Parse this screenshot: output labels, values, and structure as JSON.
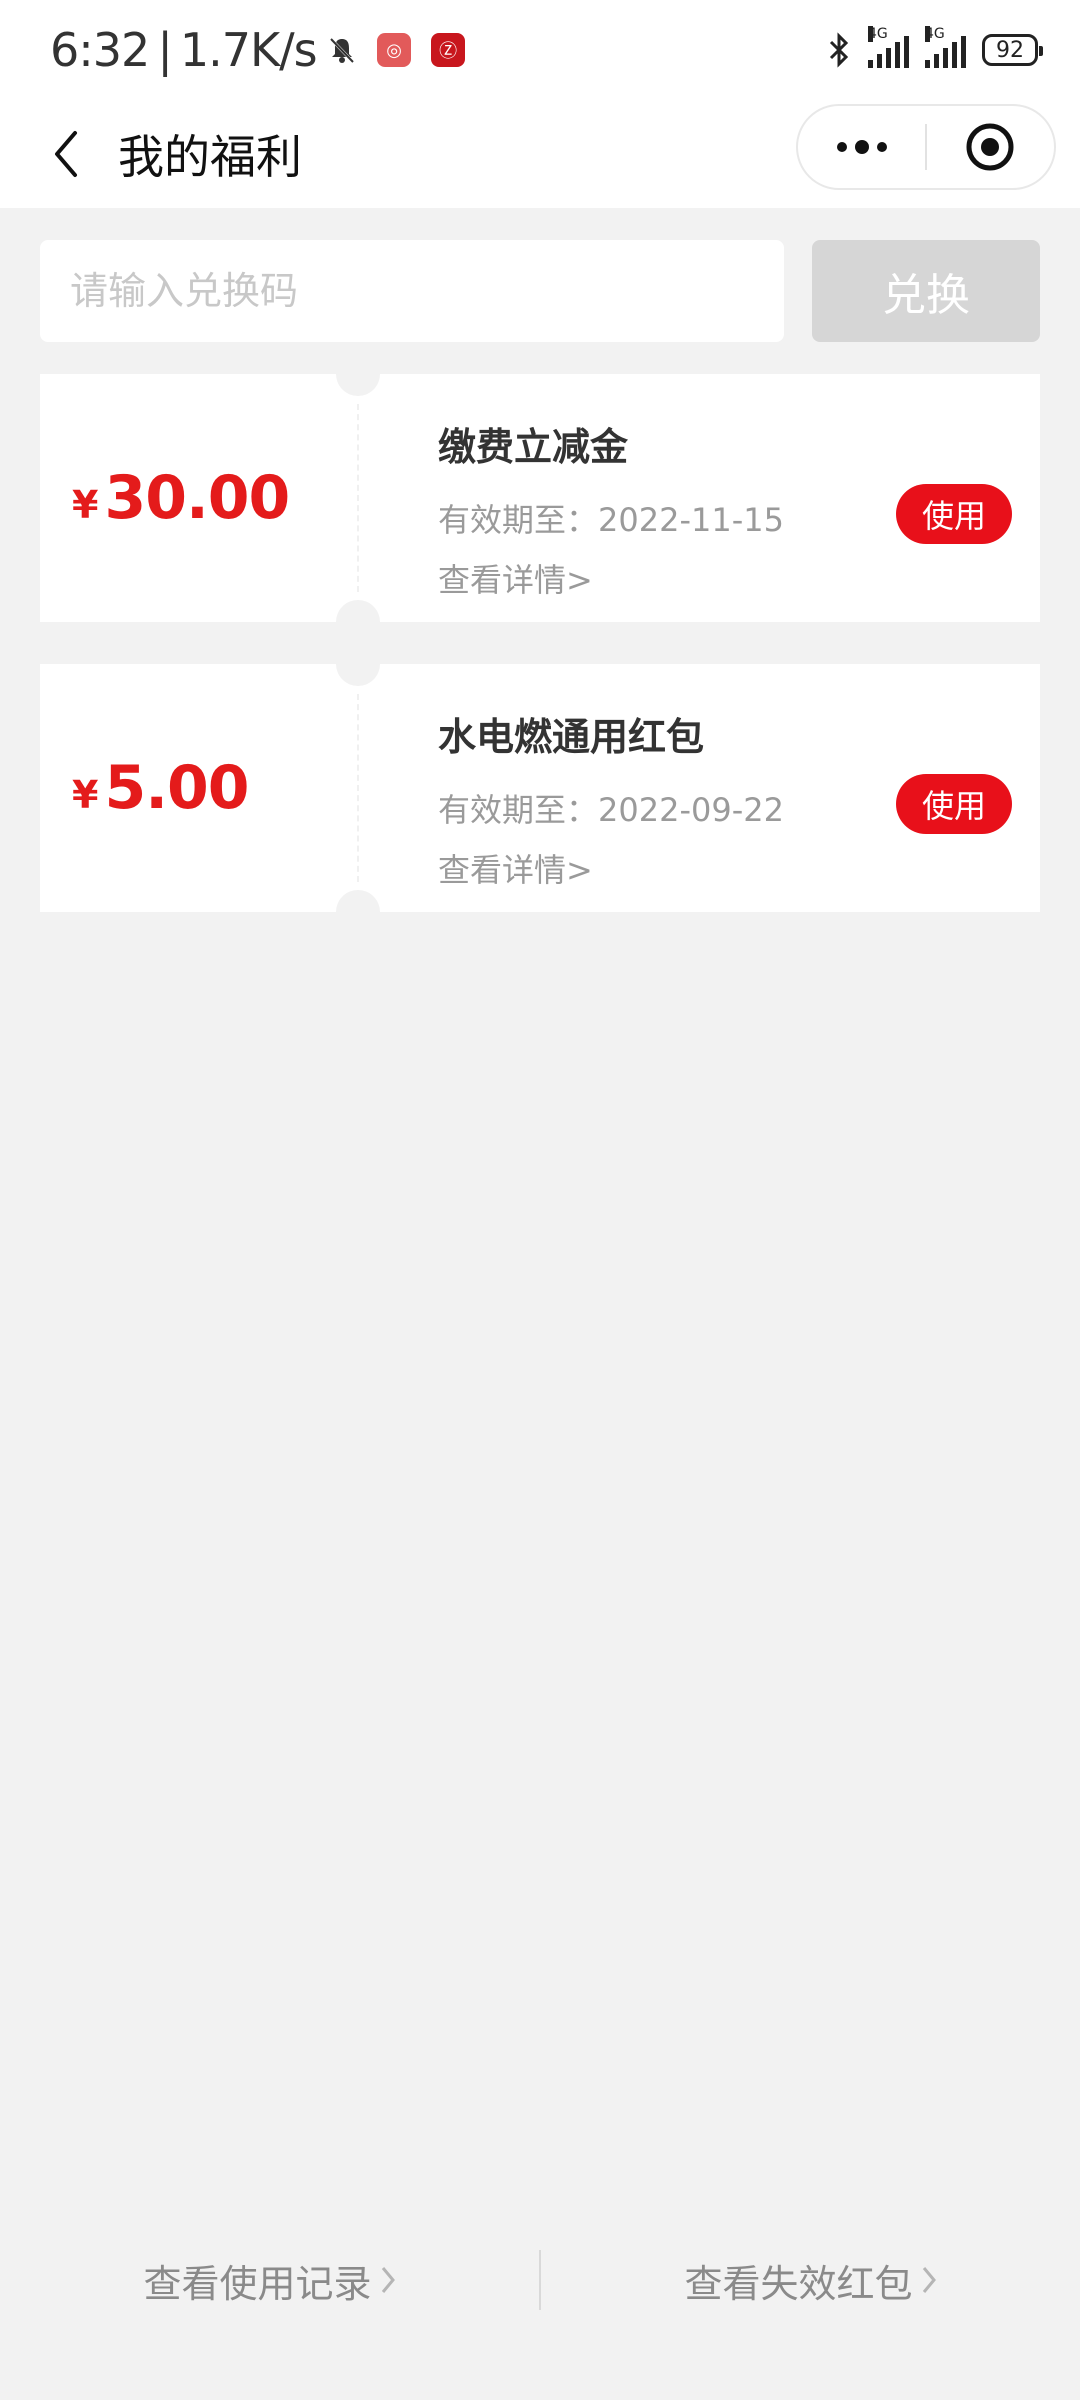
{
  "status_bar": {
    "time": "6:32",
    "network_speed": "1.7K/s",
    "separator": "|",
    "net_type_1": "4G",
    "net_type_2": "4G",
    "battery": "92",
    "icons": [
      "mute-bell-icon",
      "app-notification-icon",
      "app-notification-icon",
      "bluetooth-icon",
      "signal-icon",
      "signal-icon",
      "battery-icon"
    ]
  },
  "nav": {
    "title": "我的福利"
  },
  "redeem": {
    "placeholder": "请输入兑换码",
    "button_label": "兑换"
  },
  "coupons": [
    {
      "currency": "¥",
      "amount": "30.00",
      "title": "缴费立减金",
      "validity": "有效期至：2022-11-15",
      "details_link": "查看详情>",
      "use_label": "使用"
    },
    {
      "currency": "¥",
      "amount": "5.00",
      "title": "水电燃通用红包",
      "validity": "有效期至：2022-09-22",
      "details_link": "查看详情>",
      "use_label": "使用"
    }
  ],
  "footer": {
    "usage_record": "查看使用记录",
    "expired_packets": "查看失效红包"
  },
  "colors": {
    "accent_red": "#e41b1b",
    "use_button_red": "#e8101a",
    "page_background": "#f2f2f2",
    "disabled_button": "#d6d6d6"
  }
}
